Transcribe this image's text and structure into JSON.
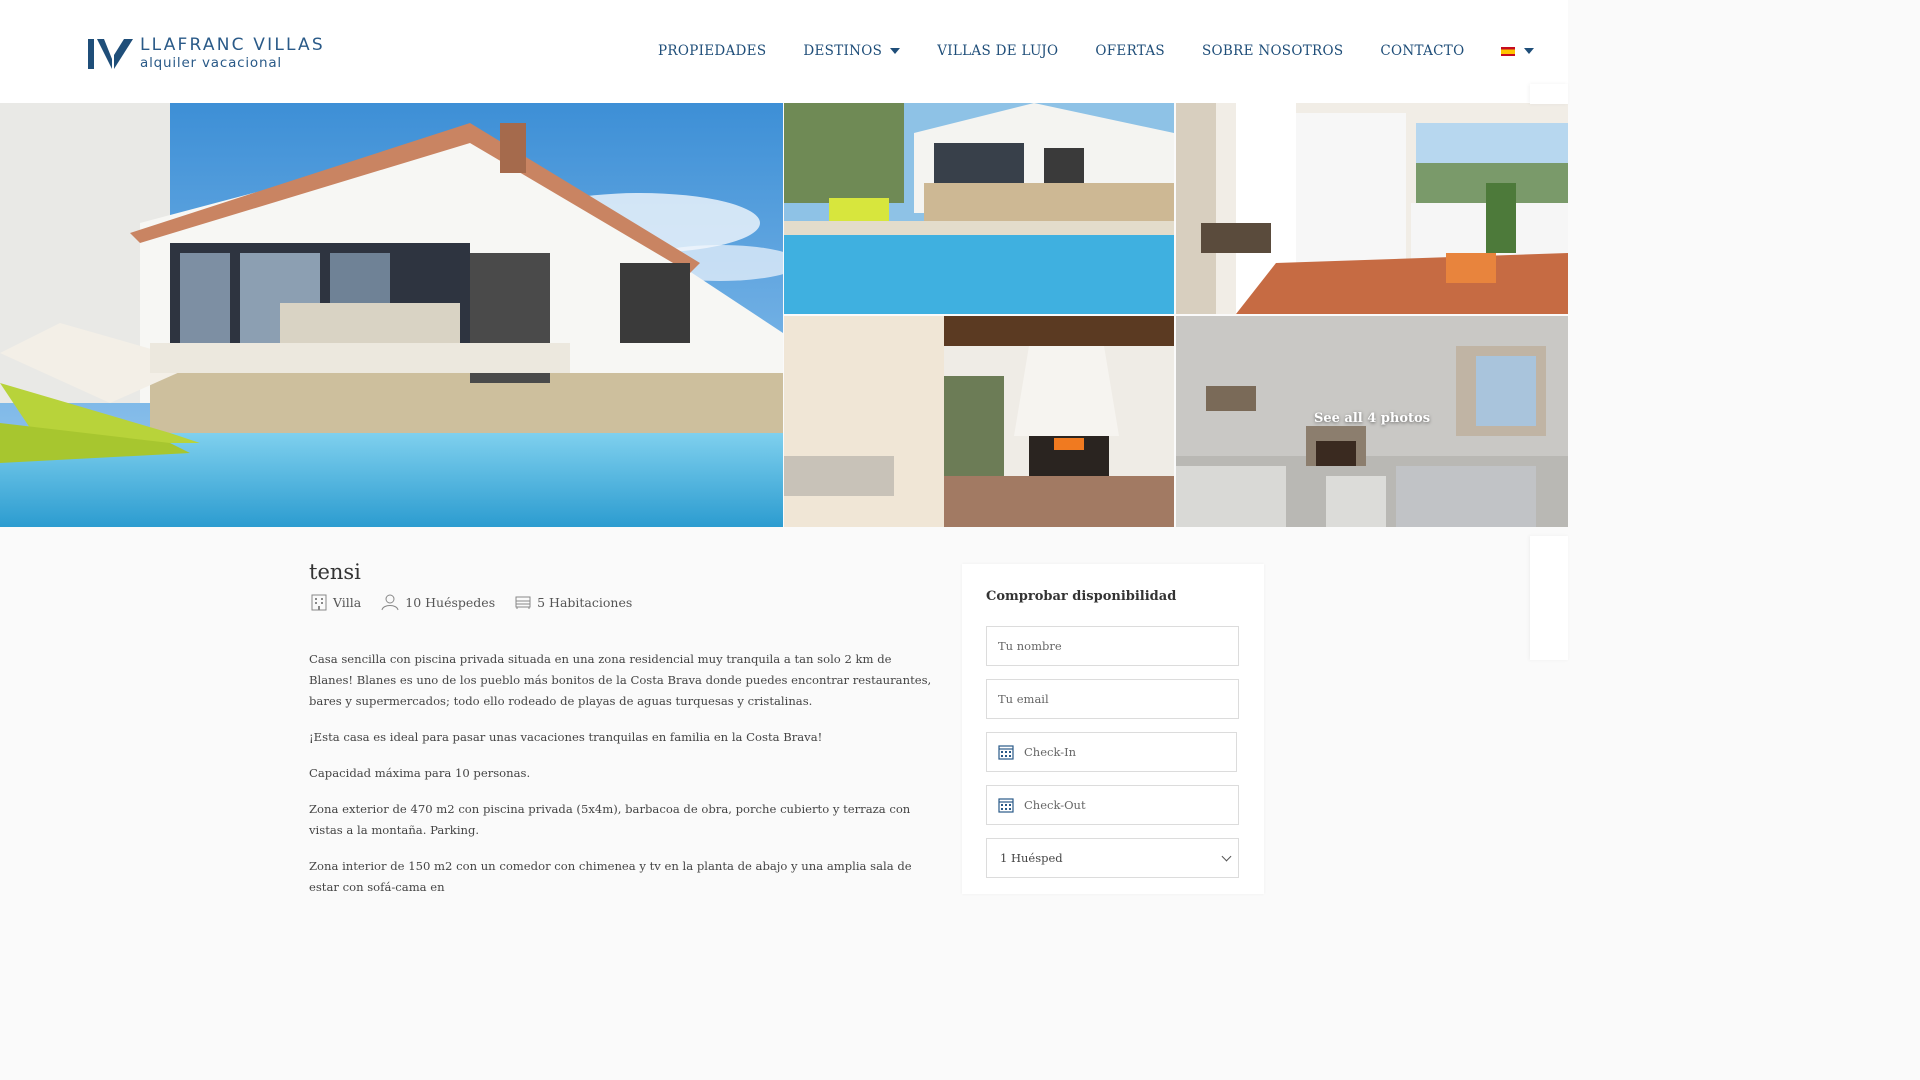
{
  "header": {
    "brand_name": "LLAFRANC VILLAS",
    "brand_tagline": "alquiler vacacional",
    "nav": [
      {
        "label": "PROPIEDADES"
      },
      {
        "label": "DESTINOS"
      },
      {
        "label": "VILLAS DE LUJO"
      },
      {
        "label": "OFERTAS"
      },
      {
        "label": "SOBRE NOSOTROS"
      },
      {
        "label": "CONTACTO"
      }
    ],
    "language_icon": "spain-flag-icon"
  },
  "gallery": {
    "see_all_label": "See all 4 photos"
  },
  "property": {
    "title": "tensi",
    "type": "Villa",
    "guests": "10 Huéspedes",
    "bedrooms": "5 Habitaciones",
    "description": [
      "Casa sencilla con piscina privada situada en una zona residencial muy tranquila a tan solo 2 km de Blanes! Blanes es uno de los pueblo más bonitos de la Costa Brava donde puedes encontrar restaurantes, bares y supermercados; todo ello rodeado de playas de aguas turquesas y cristalinas.",
      "¡Esta casa es ideal para pasar unas vacaciones tranquilas en familia en la Costa Brava!",
      "Capacidad máxima para 10 personas.",
      "Zona exterior de 470 m2 con piscina privada (5x4m), barbacoa de obra, porche cubierto y terraza con vistas a la montaña. Parking.",
      "Zona interior de 150 m2 con un comedor con chimenea y tv en la planta de abajo y una amplia sala de estar con sofá-cama en"
    ]
  },
  "booking": {
    "title": "Comprobar disponibilidad",
    "name_placeholder": "Tu nombre",
    "email_placeholder": "Tu email",
    "checkin_placeholder": "Check-In",
    "checkout_placeholder": "Check-Out",
    "guests_value": "1 Huésped"
  },
  "colors": {
    "brand": "#1f4e79",
    "background": "#fafafa"
  }
}
